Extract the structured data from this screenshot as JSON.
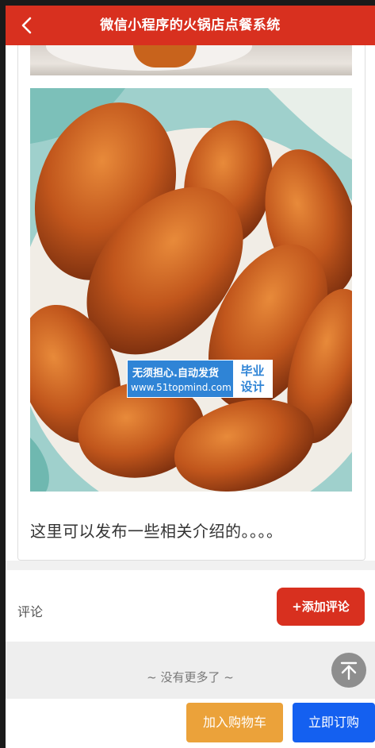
{
  "header": {
    "title": "微信小程序的火锅店点餐系统",
    "back_icon": "chevron-left-icon"
  },
  "detail": {
    "description": "这里可以发布一些相关介绍的。。。。"
  },
  "watermark": {
    "line1": "无须担心.自动发货",
    "line2": "www.51topmind.com",
    "badge_line1": "毕业",
    "badge_line2": "设计"
  },
  "comments": {
    "label": "评论",
    "add_button": "+添加评论",
    "empty_text": "~ 没有更多了 ~"
  },
  "actions": {
    "add_to_cart": "加入购物车",
    "order_now": "立即订购",
    "back_to_top_icon": "arrow-up-icon"
  },
  "colors": {
    "primary_red": "#d8301f",
    "cart_orange": "#eba23a",
    "order_blue": "#1460f0"
  }
}
